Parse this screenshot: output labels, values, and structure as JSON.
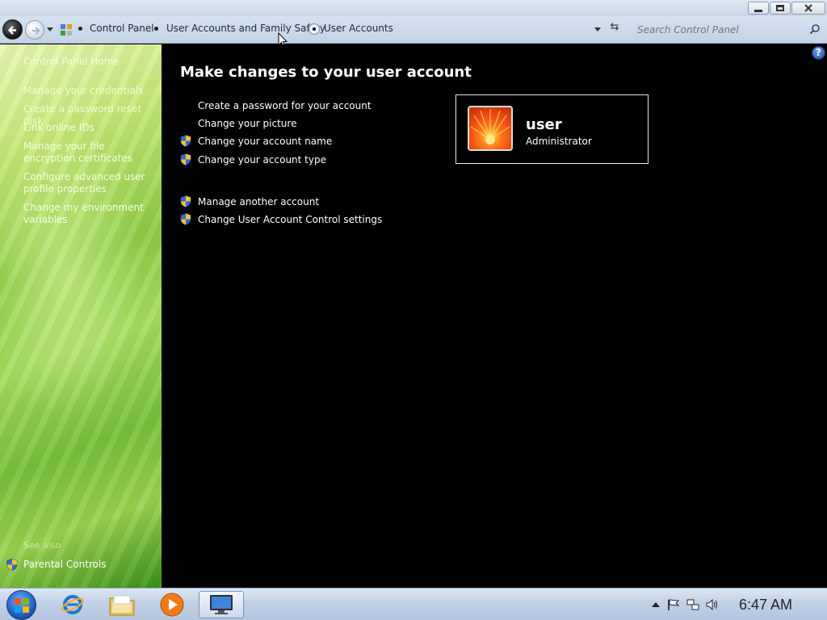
{
  "window": {
    "minimize_label": "minimize",
    "maximize_label": "restore",
    "close_label": "close"
  },
  "address": {
    "breadcrumbs": [
      "Control Panel",
      "User Accounts and Family Safety",
      "User Accounts"
    ]
  },
  "search": {
    "placeholder": "Search Control Panel"
  },
  "sidebar": {
    "home_label": "Control Panel Home",
    "links": [
      "Manage your credentials",
      "Create a password reset disk",
      "Link online IDs",
      "Manage your file encryption certificates",
      "Configure advanced user profile properties",
      "Change my environment variables"
    ],
    "see_also_label": "See also",
    "parental_controls": "Parental Controls"
  },
  "main": {
    "title": "Make changes to your user account",
    "tasks": [
      {
        "label": "Create a password for your account",
        "shield": false
      },
      {
        "label": "Change your picture",
        "shield": false
      },
      {
        "label": "Change your account name",
        "shield": true
      },
      {
        "label": "Change your account type",
        "shield": true
      }
    ],
    "other_tasks": [
      {
        "label": "Manage another account",
        "shield": true
      },
      {
        "label": "Change User Account Control settings",
        "shield": true
      }
    ]
  },
  "user": {
    "name": "user",
    "role": "Administrator"
  },
  "taskbar": {
    "clock": "6:47 AM"
  },
  "colors": {
    "accent_green": "#8fcc45",
    "content_bg": "#000000",
    "taskbar_blue": "#c1d1e5"
  }
}
